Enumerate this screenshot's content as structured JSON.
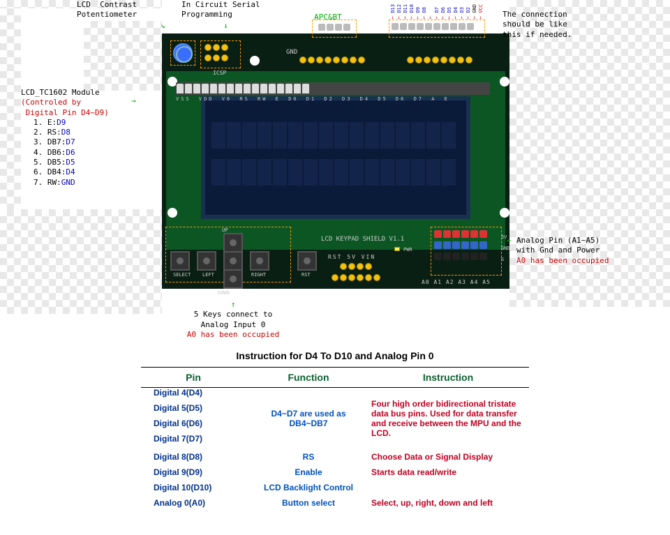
{
  "annotations": {
    "pot": "LCD  Contrast\nPotentiometer",
    "icsp": "In Circuit Serial\nProgramming",
    "apcbt": "APC&BT",
    "conn": "The connection\nshould be like\nthis if needed.",
    "lcd_title": "LCD_TC1602 Module",
    "lcd_ctrl": "(Controled by\n Digital Pin D4~D9)",
    "lcd_pins": [
      "1. E:D9",
      "2. RS:D8",
      "3. DB7:D7",
      "4. DB6:D6",
      "5. DB5:D5",
      "6. DB4:D4",
      "7. RW:GND"
    ],
    "keys": "5 Keys connect to\nAnalog Input 0",
    "keys_red": "A0 has been occupied",
    "apin": "Analog Pin (A1~A5)\nwith Gnd and Power",
    "apin_red": "A0 has been occupied"
  },
  "arduino_pins": [
    "D13",
    "D12",
    "D11",
    "D10",
    "D9",
    "D8",
    "",
    "D7",
    "D6",
    "D5",
    "D4",
    "D3",
    "D2",
    "GND",
    "VCC"
  ],
  "header_labels": "VSS VDD V0 RS RW E D0 D1 D2 D3 D4 D5 D6 D7 A E",
  "buttons": {
    "select": "SELECT",
    "left": "LEFT",
    "up": "UP",
    "down": "DOWN",
    "right": "RIGHT",
    "rst": "RST"
  },
  "shield": "LCD KEYPAD SHIELD V1.1",
  "rst_row": "RST   5V    VIN",
  "apin_labels": "A0 A1 A2 A3 A4 A5",
  "apin_side": [
    "5V",
    "GND",
    "S"
  ],
  "gnd": "GND",
  "icsp_lbl": "ICSP",
  "pwr": "PWR",
  "table": {
    "title": "Instruction for D4 To D10 and Analog Pin 0",
    "headers": [
      "Pin",
      "Function",
      "Instruction"
    ],
    "rows": [
      {
        "pin": "Digital   4(D4)",
        "func": "",
        "inst": ""
      },
      {
        "pin": "Digital   5(D5)",
        "func": "D4~D7 are used as",
        "inst": "Four high order bidirectional tristate data bus pins. Used for data transfer and receive between the MPU and the LCD."
      },
      {
        "pin": "Digital   6(D6)",
        "func": "DB4~DB7",
        "inst": ""
      },
      {
        "pin": "Digital   7(D7)",
        "func": "",
        "inst": ""
      },
      {
        "pin": "Digital   8(D8)",
        "func": "RS",
        "inst": "Choose Data or Signal Display"
      },
      {
        "pin": "Digital   9(D9)",
        "func": "Enable",
        "inst": "Starts data read/write"
      },
      {
        "pin": "Digital 10(D10)",
        "func": "LCD Backlight Control",
        "inst": ""
      },
      {
        "pin": "Analog  0(A0)",
        "func": "Button select",
        "inst": "Select, up, right, down and left"
      }
    ]
  }
}
